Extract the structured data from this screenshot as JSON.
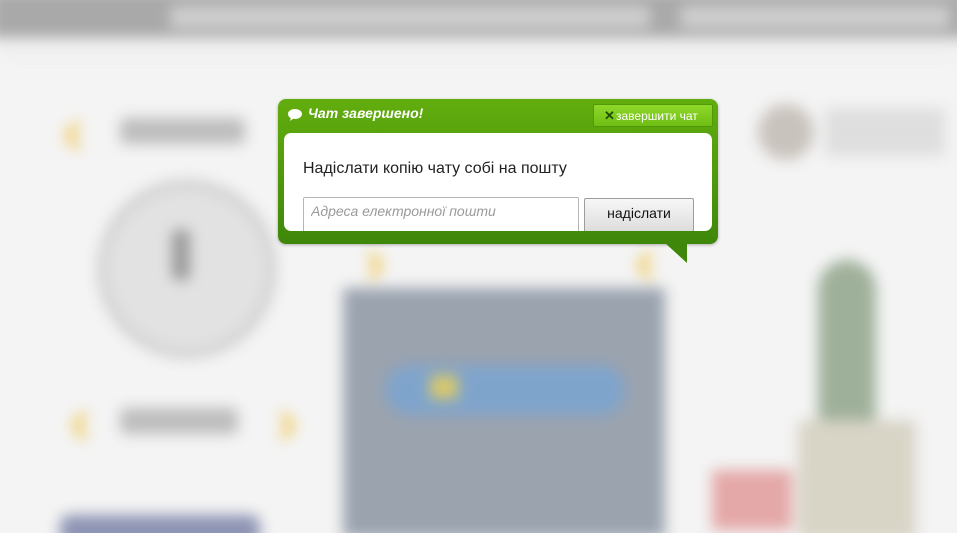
{
  "chat": {
    "title": "Чат завершено!",
    "end_button_icon": "close-icon",
    "end_button_label": "завершити чат",
    "copy_prompt": "Надіслати копію чату собі на пошту",
    "email_placeholder": "Адреса електронної пошти",
    "email_value": "",
    "send_label": "надіслати",
    "title_icon": "speech-bubble-icon"
  },
  "colors": {
    "header_green": "#4f9a0c",
    "button_green": "#7cc81c",
    "body_white": "#ffffff"
  }
}
